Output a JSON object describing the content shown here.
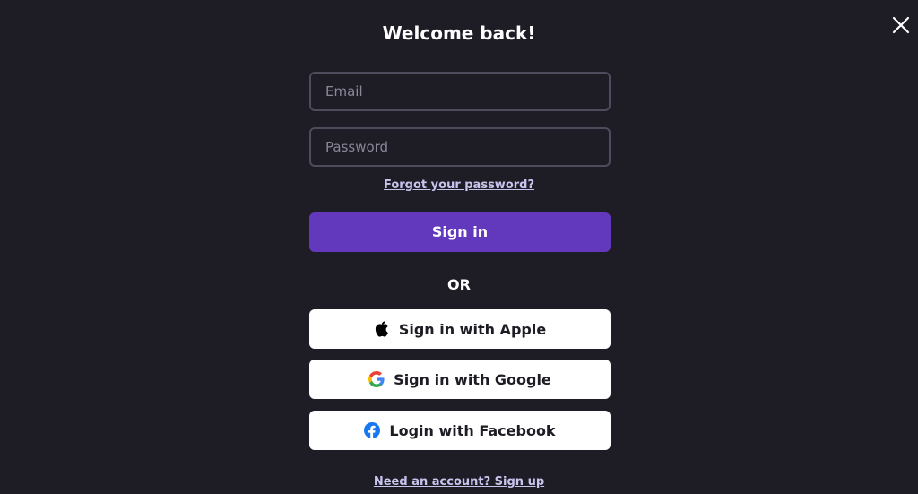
{
  "dialog": {
    "title": "Welcome back!",
    "close_icon": "close-icon"
  },
  "form": {
    "email_placeholder": "Email",
    "email_value": "",
    "password_placeholder": "Password",
    "password_value": "",
    "forgot_password_label": "Forgot your password?",
    "sign_in_label": "Sign in",
    "or_label": "OR"
  },
  "social": {
    "apple_label": "Sign in with Apple",
    "apple_icon": "apple-icon",
    "google_label": "Sign in with Google",
    "google_icon": "google-icon",
    "facebook_label": "Login with Facebook",
    "facebook_icon": "facebook-icon"
  },
  "footer": {
    "signup_label": "Need an account? Sign up"
  },
  "colors": {
    "background": "#1e1c25",
    "primary_button": "#6239bc",
    "link": "#c7c4ee",
    "input_border": "#4e4b5c"
  }
}
